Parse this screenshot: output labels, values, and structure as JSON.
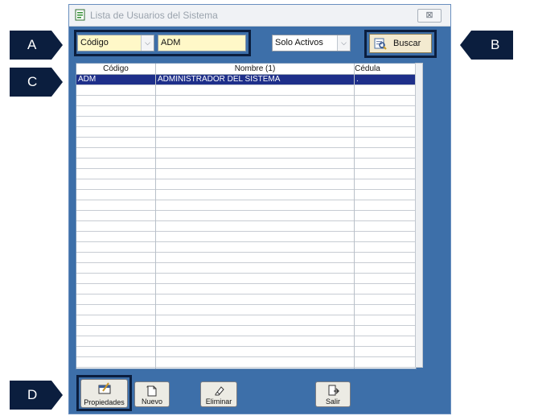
{
  "window": {
    "title": "Lista de Usuarios del Sistema",
    "close_symbol": "⊠"
  },
  "search": {
    "field_combo": "Código",
    "value": "ADM",
    "status_combo": "Solo Activos",
    "buscar_label": "Buscar"
  },
  "table": {
    "columns": [
      "Código",
      "Nombre (1)",
      "Cédula"
    ],
    "rows": [
      {
        "codigo": "ADM",
        "nombre": "ADMINISTRADOR DEL SISTEMA",
        "cedula": "."
      }
    ],
    "selected_row": 0
  },
  "footer": {
    "propiedades": "Propiedades",
    "nuevo": "Nuevo",
    "eliminar": "Eliminar",
    "salir": "Salir"
  },
  "callouts": {
    "a": "A",
    "b": "B",
    "c": "C",
    "d": "D"
  },
  "colors": {
    "window_bg": "#3d6fa9",
    "input_bg": "#fff8c8",
    "selected_row": "#1e2f8a",
    "callout": "#0b1e3e"
  },
  "icons": [
    "app-icon",
    "close-icon",
    "chevron-down-icon",
    "search-icon",
    "properties-icon",
    "new-document-icon",
    "eraser-icon",
    "exit-icon"
  ]
}
